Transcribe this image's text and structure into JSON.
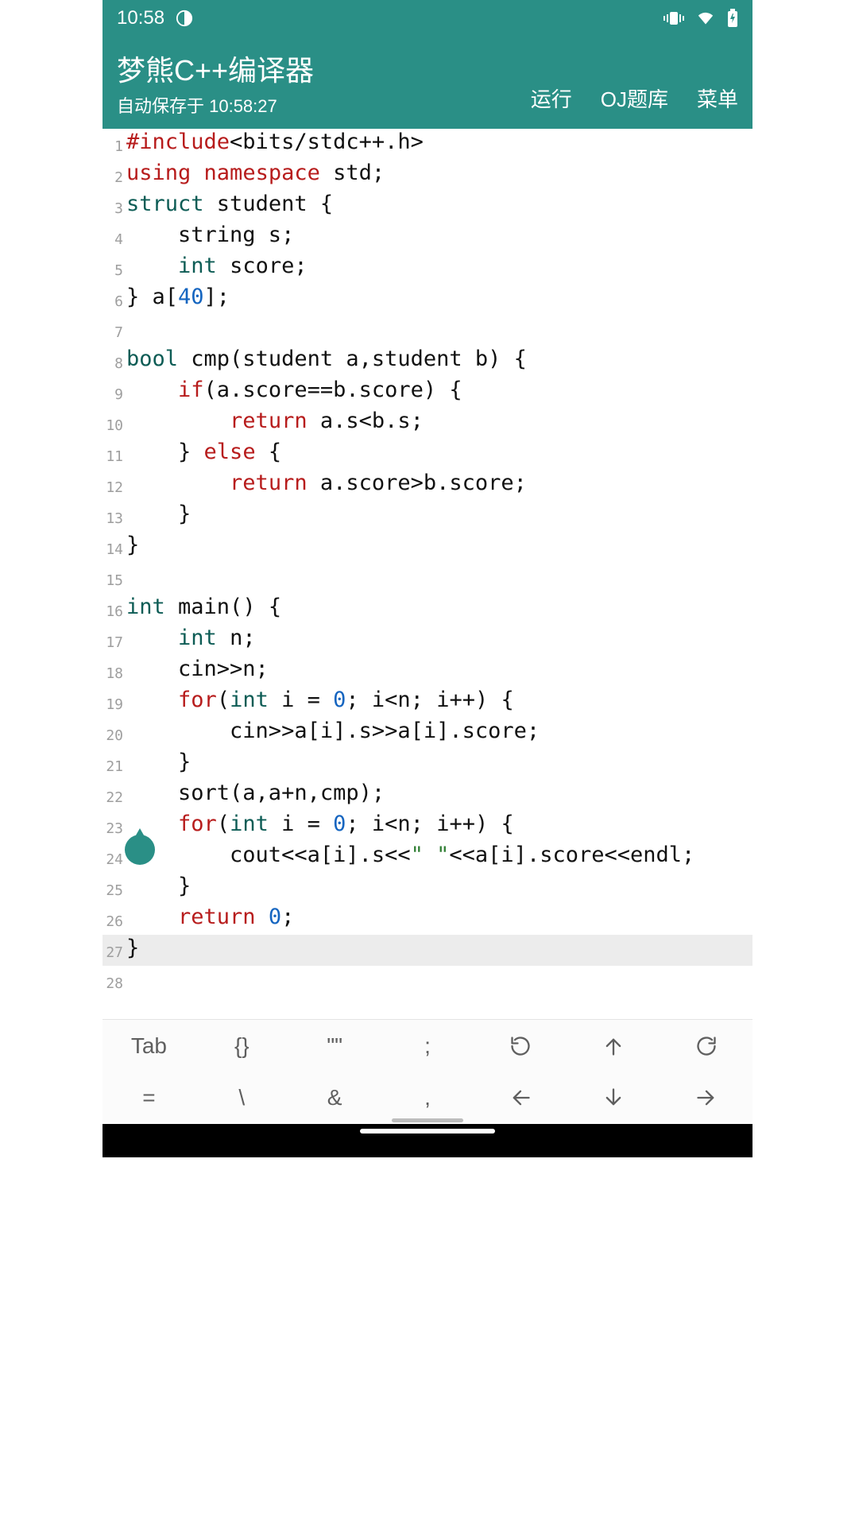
{
  "status": {
    "time": "10:58"
  },
  "header": {
    "title": "梦熊C++编译器",
    "subtitle": "自动保存于 10:58:27",
    "actions": {
      "run": "运行",
      "oj": "OJ题库",
      "menu": "菜单"
    }
  },
  "editor": {
    "highlight_line": 27,
    "lines": [
      {
        "n": 1,
        "tokens": [
          [
            "pre",
            "#include"
          ],
          [
            "plain",
            "<bits/stdc++.h>"
          ]
        ]
      },
      {
        "n": 2,
        "tokens": [
          [
            "ctrl",
            "using"
          ],
          [
            "plain",
            " "
          ],
          [
            "ctrl",
            "namespace"
          ],
          [
            "plain",
            " std;"
          ]
        ]
      },
      {
        "n": 3,
        "tokens": [
          [
            "kw",
            "struct"
          ],
          [
            "plain",
            " student {"
          ]
        ]
      },
      {
        "n": 4,
        "tokens": [
          [
            "plain",
            "    string s;"
          ]
        ]
      },
      {
        "n": 5,
        "tokens": [
          [
            "plain",
            "    "
          ],
          [
            "kw",
            "int"
          ],
          [
            "plain",
            " score;"
          ]
        ]
      },
      {
        "n": 6,
        "tokens": [
          [
            "plain",
            "} a["
          ],
          [
            "num",
            "40"
          ],
          [
            "plain",
            "];"
          ]
        ]
      },
      {
        "n": 7,
        "tokens": [
          [
            "plain",
            ""
          ]
        ]
      },
      {
        "n": 8,
        "tokens": [
          [
            "kw",
            "bool"
          ],
          [
            "plain",
            " cmp(student a,student b) {"
          ]
        ]
      },
      {
        "n": 9,
        "tokens": [
          [
            "plain",
            "    "
          ],
          [
            "ctrl",
            "if"
          ],
          [
            "plain",
            "(a.score==b.score) {"
          ]
        ]
      },
      {
        "n": 10,
        "tokens": [
          [
            "plain",
            "        "
          ],
          [
            "ctrl",
            "return"
          ],
          [
            "plain",
            " a.s<b.s;"
          ]
        ]
      },
      {
        "n": 11,
        "tokens": [
          [
            "plain",
            "    } "
          ],
          [
            "ctrl",
            "else"
          ],
          [
            "plain",
            " {"
          ]
        ]
      },
      {
        "n": 12,
        "tokens": [
          [
            "plain",
            "        "
          ],
          [
            "ctrl",
            "return"
          ],
          [
            "plain",
            " a.score>b.score;"
          ]
        ]
      },
      {
        "n": 13,
        "tokens": [
          [
            "plain",
            "    }"
          ]
        ]
      },
      {
        "n": 14,
        "tokens": [
          [
            "plain",
            "}"
          ]
        ]
      },
      {
        "n": 15,
        "tokens": [
          [
            "plain",
            ""
          ]
        ]
      },
      {
        "n": 16,
        "tokens": [
          [
            "kw",
            "int"
          ],
          [
            "plain",
            " main() {"
          ]
        ]
      },
      {
        "n": 17,
        "tokens": [
          [
            "plain",
            "    "
          ],
          [
            "kw",
            "int"
          ],
          [
            "plain",
            " n;"
          ]
        ]
      },
      {
        "n": 18,
        "tokens": [
          [
            "plain",
            "    cin>>n;"
          ]
        ]
      },
      {
        "n": 19,
        "tokens": [
          [
            "plain",
            "    "
          ],
          [
            "ctrl",
            "for"
          ],
          [
            "plain",
            "("
          ],
          [
            "kw",
            "int"
          ],
          [
            "plain",
            " i = "
          ],
          [
            "num",
            "0"
          ],
          [
            "plain",
            "; i<n; i++) {"
          ]
        ]
      },
      {
        "n": 20,
        "tokens": [
          [
            "plain",
            "        cin>>a[i].s>>a[i].score;"
          ]
        ]
      },
      {
        "n": 21,
        "tokens": [
          [
            "plain",
            "    }"
          ]
        ]
      },
      {
        "n": 22,
        "tokens": [
          [
            "plain",
            "    sort(a,a+n,cmp);"
          ]
        ]
      },
      {
        "n": 23,
        "tokens": [
          [
            "plain",
            "    "
          ],
          [
            "ctrl",
            "for"
          ],
          [
            "plain",
            "("
          ],
          [
            "kw",
            "int"
          ],
          [
            "plain",
            " i = "
          ],
          [
            "num",
            "0"
          ],
          [
            "plain",
            "; i<n; i++) {"
          ]
        ]
      },
      {
        "n": 24,
        "tokens": [
          [
            "plain",
            "        cout<<a[i].s<<"
          ],
          [
            "str",
            "\" \""
          ],
          [
            "plain",
            "<<a[i].score<<endl;"
          ]
        ]
      },
      {
        "n": 25,
        "tokens": [
          [
            "plain",
            "    }"
          ]
        ]
      },
      {
        "n": 26,
        "tokens": [
          [
            "plain",
            "    "
          ],
          [
            "ctrl",
            "return"
          ],
          [
            "plain",
            " "
          ],
          [
            "num",
            "0"
          ],
          [
            "plain",
            ";"
          ]
        ]
      },
      {
        "n": 27,
        "tokens": [
          [
            "plain",
            "}"
          ]
        ]
      },
      {
        "n": 28,
        "tokens": [
          [
            "plain",
            ""
          ]
        ]
      }
    ]
  },
  "toolbar": {
    "row1": [
      "Tab",
      "{}",
      "\"\"",
      ";",
      "undo-icon",
      "shift-up-icon",
      "redo-icon"
    ],
    "row2": [
      "=",
      "\\",
      "&",
      ",",
      "arrow-left-icon",
      "arrow-down-icon",
      "arrow-right-icon"
    ]
  }
}
